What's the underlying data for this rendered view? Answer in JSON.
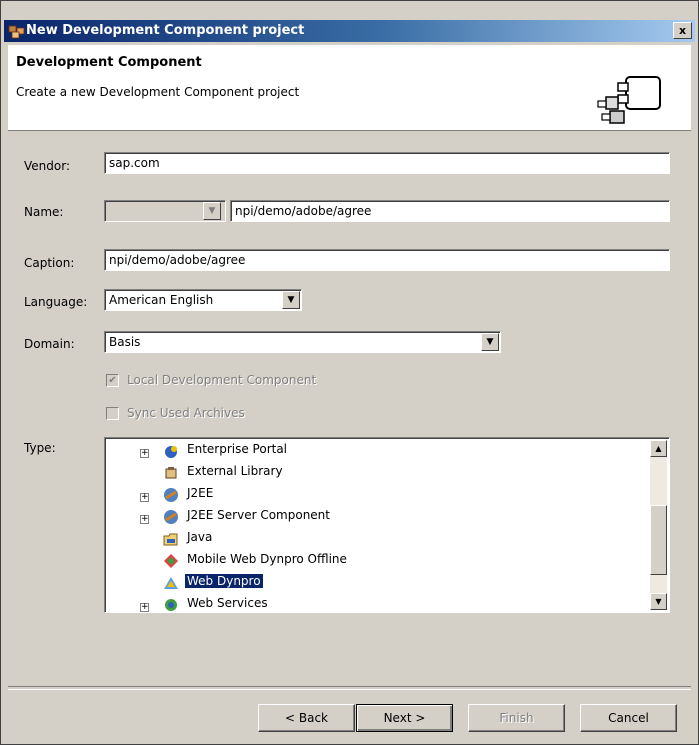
{
  "window": {
    "title": "New Development Component project",
    "close_label": "x"
  },
  "banner": {
    "title": "Development Component",
    "description": "Create a new Development Component project",
    "icon": "wizard-components-icon"
  },
  "form": {
    "vendor": {
      "label": "Vendor:",
      "value": "sap.com"
    },
    "name": {
      "label": "Name:",
      "prefix_value": "",
      "value": "npi/demo/adobe/agree"
    },
    "caption": {
      "label": "Caption:",
      "value": "npi/demo/adobe/agree"
    },
    "language": {
      "label": "Language:",
      "value": "American English"
    },
    "domain": {
      "label": "Domain:",
      "value": "Basis"
    },
    "local_dc": {
      "label": "Local Development Component",
      "checked": true,
      "enabled": false
    },
    "sync_archives": {
      "label": "Sync Used Archives",
      "checked": false,
      "enabled": false
    },
    "type_label": "Type:"
  },
  "type_tree": {
    "items": [
      {
        "label": "Enterprise Portal",
        "expandable": true,
        "icon": "portal-icon"
      },
      {
        "label": "External Library",
        "expandable": false,
        "icon": "library-icon"
      },
      {
        "label": "J2EE",
        "expandable": true,
        "icon": "j2ee-icon"
      },
      {
        "label": "J2EE Server Component",
        "expandable": true,
        "icon": "server-component-icon"
      },
      {
        "label": "Java",
        "expandable": false,
        "icon": "java-folder-icon"
      },
      {
        "label": "Mobile Web Dynpro Offline",
        "expandable": false,
        "icon": "mobile-icon"
      },
      {
        "label": "Web Dynpro",
        "expandable": false,
        "icon": "web-dynpro-icon",
        "selected": true
      },
      {
        "label": "Web Services",
        "expandable": true,
        "icon": "web-services-icon"
      }
    ],
    "scroll_position": 0.75
  },
  "buttons": {
    "back": "< Back",
    "next": "Next >",
    "finish": "Finish",
    "cancel": "Cancel"
  },
  "colors": {
    "title_bar": "#0a246a",
    "dialog_bg": "#d4d0c8",
    "selection": "#0a246a"
  }
}
